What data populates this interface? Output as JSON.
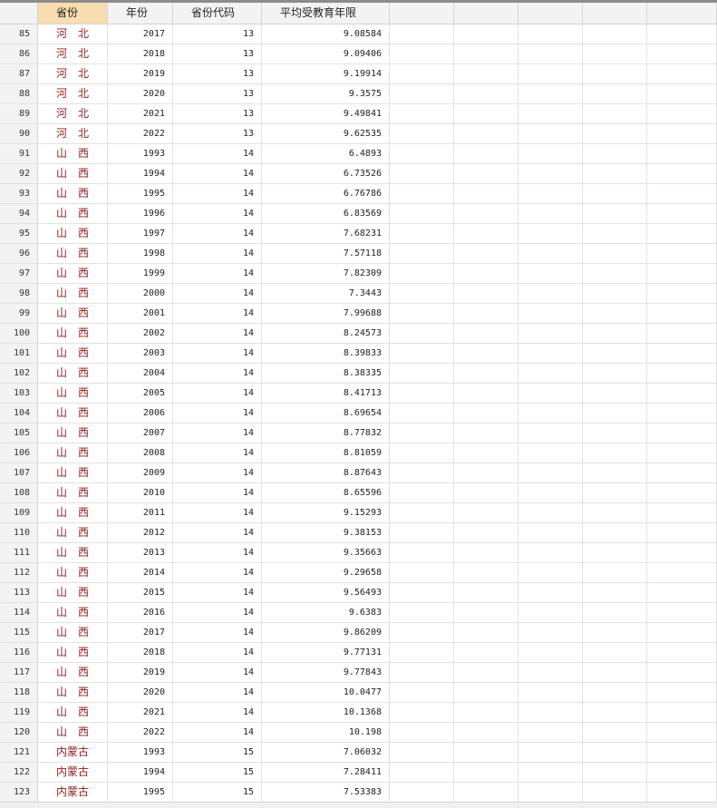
{
  "columns": [
    "省份",
    "年份",
    "省份代码",
    "平均受教育年限"
  ],
  "selected_column": 0,
  "rows": [
    {
      "n": "85",
      "province": "河　北",
      "year": "2017",
      "code": "13",
      "edu": "9.08584"
    },
    {
      "n": "86",
      "province": "河　北",
      "year": "2018",
      "code": "13",
      "edu": "9.09406"
    },
    {
      "n": "87",
      "province": "河　北",
      "year": "2019",
      "code": "13",
      "edu": "9.19914"
    },
    {
      "n": "88",
      "province": "河　北",
      "year": "2020",
      "code": "13",
      "edu": "9.3575"
    },
    {
      "n": "89",
      "province": "河　北",
      "year": "2021",
      "code": "13",
      "edu": "9.49841"
    },
    {
      "n": "90",
      "province": "河　北",
      "year": "2022",
      "code": "13",
      "edu": "9.62535"
    },
    {
      "n": "91",
      "province": "山　西",
      "year": "1993",
      "code": "14",
      "edu": "6.4893"
    },
    {
      "n": "92",
      "province": "山　西",
      "year": "1994",
      "code": "14",
      "edu": "6.73526"
    },
    {
      "n": "93",
      "province": "山　西",
      "year": "1995",
      "code": "14",
      "edu": "6.76786"
    },
    {
      "n": "94",
      "province": "山　西",
      "year": "1996",
      "code": "14",
      "edu": "6.83569"
    },
    {
      "n": "95",
      "province": "山　西",
      "year": "1997",
      "code": "14",
      "edu": "7.68231"
    },
    {
      "n": "96",
      "province": "山　西",
      "year": "1998",
      "code": "14",
      "edu": "7.57118"
    },
    {
      "n": "97",
      "province": "山　西",
      "year": "1999",
      "code": "14",
      "edu": "7.82309"
    },
    {
      "n": "98",
      "province": "山　西",
      "year": "2000",
      "code": "14",
      "edu": "7.3443"
    },
    {
      "n": "99",
      "province": "山　西",
      "year": "2001",
      "code": "14",
      "edu": "7.99688"
    },
    {
      "n": "100",
      "province": "山　西",
      "year": "2002",
      "code": "14",
      "edu": "8.24573"
    },
    {
      "n": "101",
      "province": "山　西",
      "year": "2003",
      "code": "14",
      "edu": "8.39833"
    },
    {
      "n": "102",
      "province": "山　西",
      "year": "2004",
      "code": "14",
      "edu": "8.38335"
    },
    {
      "n": "103",
      "province": "山　西",
      "year": "2005",
      "code": "14",
      "edu": "8.41713"
    },
    {
      "n": "104",
      "province": "山　西",
      "year": "2006",
      "code": "14",
      "edu": "8.69654"
    },
    {
      "n": "105",
      "province": "山　西",
      "year": "2007",
      "code": "14",
      "edu": "8.77832"
    },
    {
      "n": "106",
      "province": "山　西",
      "year": "2008",
      "code": "14",
      "edu": "8.81059"
    },
    {
      "n": "107",
      "province": "山　西",
      "year": "2009",
      "code": "14",
      "edu": "8.87643"
    },
    {
      "n": "108",
      "province": "山　西",
      "year": "2010",
      "code": "14",
      "edu": "8.65596"
    },
    {
      "n": "109",
      "province": "山　西",
      "year": "2011",
      "code": "14",
      "edu": "9.15293"
    },
    {
      "n": "110",
      "province": "山　西",
      "year": "2012",
      "code": "14",
      "edu": "9.38153"
    },
    {
      "n": "111",
      "province": "山　西",
      "year": "2013",
      "code": "14",
      "edu": "9.35663"
    },
    {
      "n": "112",
      "province": "山　西",
      "year": "2014",
      "code": "14",
      "edu": "9.29658"
    },
    {
      "n": "113",
      "province": "山　西",
      "year": "2015",
      "code": "14",
      "edu": "9.56493"
    },
    {
      "n": "114",
      "province": "山　西",
      "year": "2016",
      "code": "14",
      "edu": "9.6383"
    },
    {
      "n": "115",
      "province": "山　西",
      "year": "2017",
      "code": "14",
      "edu": "9.86209"
    },
    {
      "n": "116",
      "province": "山　西",
      "year": "2018",
      "code": "14",
      "edu": "9.77131"
    },
    {
      "n": "117",
      "province": "山　西",
      "year": "2019",
      "code": "14",
      "edu": "9.77843"
    },
    {
      "n": "118",
      "province": "山　西",
      "year": "2020",
      "code": "14",
      "edu": "10.0477"
    },
    {
      "n": "119",
      "province": "山　西",
      "year": "2021",
      "code": "14",
      "edu": "10.1368"
    },
    {
      "n": "120",
      "province": "山　西",
      "year": "2022",
      "code": "14",
      "edu": "10.198"
    },
    {
      "n": "121",
      "province": "内蒙古",
      "year": "1993",
      "code": "15",
      "edu": "7.06032"
    },
    {
      "n": "122",
      "province": "内蒙古",
      "year": "1994",
      "code": "15",
      "edu": "7.28411"
    },
    {
      "n": "123",
      "province": "内蒙古",
      "year": "1995",
      "code": "15",
      "edu": "7.53383"
    }
  ],
  "colors": {
    "province_text": "#8f1d1d",
    "selected_header": "#f7ddb0",
    "header_bg": "#f3f3f3",
    "grid": "#e2e2e2"
  }
}
